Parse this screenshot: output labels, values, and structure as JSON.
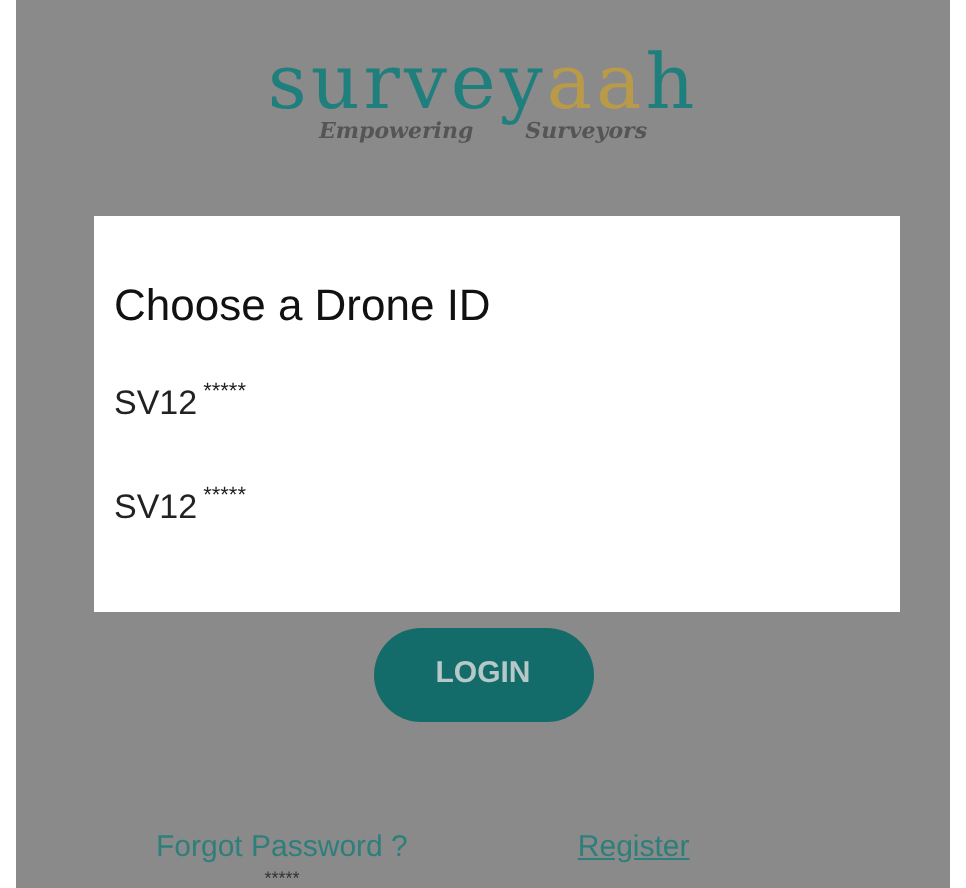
{
  "logo": {
    "wordmark": [
      {
        "text": "surve",
        "color": "#1f7f7c"
      },
      {
        "text": "y",
        "color": "#1f7f7c"
      },
      {
        "text": "aa",
        "color": "#b89a48"
      },
      {
        "text": "h",
        "color": "#1f7f7c"
      }
    ],
    "tagline": [
      "Empowering",
      "Surveyors"
    ]
  },
  "dialog": {
    "title": "Choose a Drone ID",
    "options": [
      {
        "label": "SV12",
        "mask": "*****"
      },
      {
        "label": "SV12",
        "mask": "*****"
      }
    ]
  },
  "login_button": "LOGIN",
  "forgot_password": {
    "label": "Forgot Password ?",
    "note": "*****"
  },
  "register": "Register"
}
